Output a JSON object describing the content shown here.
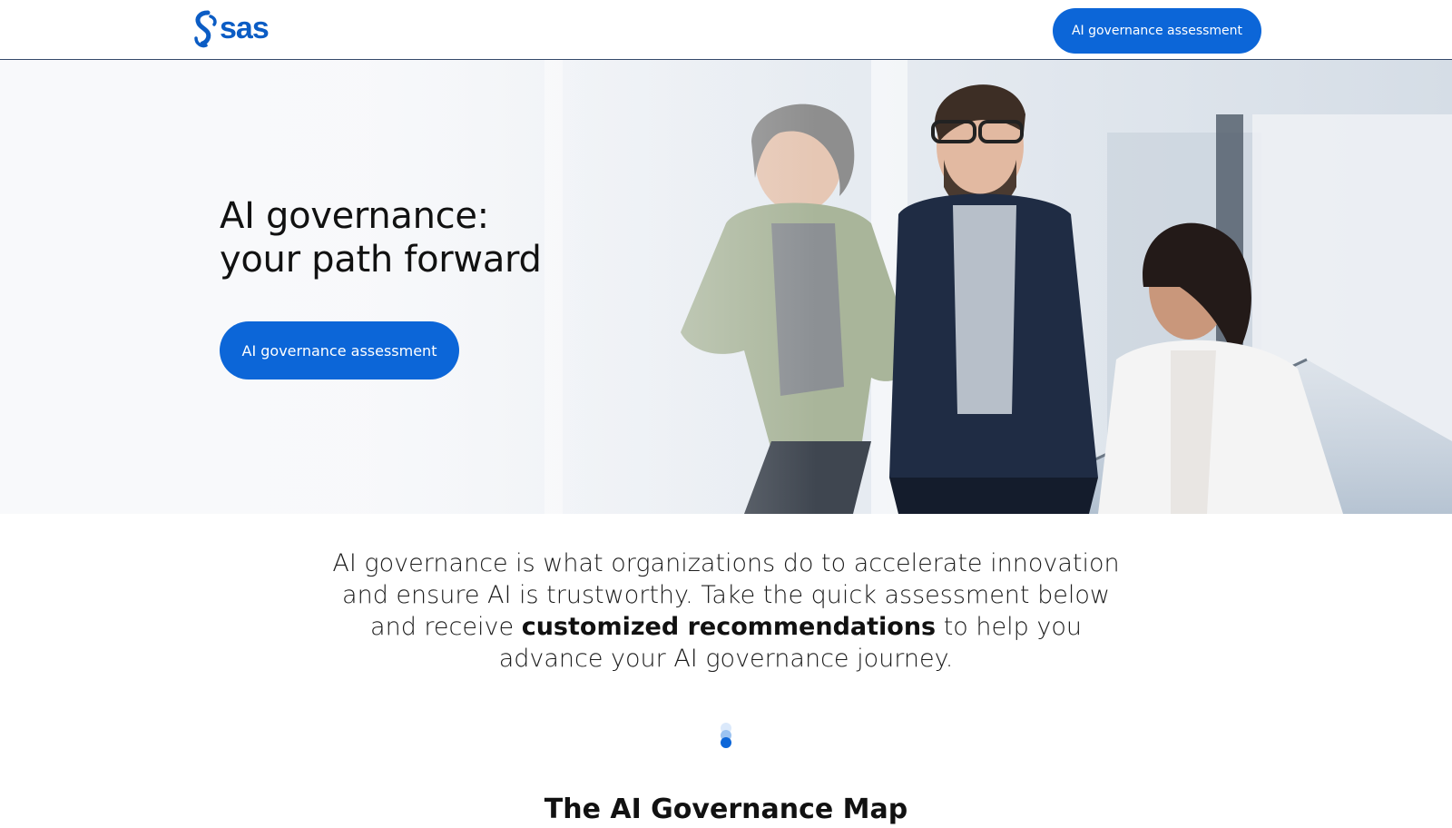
{
  "header": {
    "logo_text": "sas",
    "cta_label": "AI governance assessment"
  },
  "hero": {
    "title_line1": "AI governance:",
    "title_line2": "your path forward",
    "cta_label": "AI governance assessment"
  },
  "intro": {
    "text_before": "AI governance is what organizations do to accelerate innovation and ensure AI is trustworthy. Take the quick assessment below and receive ",
    "text_bold": "customized recommendations",
    "text_after": " to help you advance your AI governance journey."
  },
  "section": {
    "title": "The AI Governance Map"
  },
  "colors": {
    "brand_blue": "#0c66d8",
    "header_border": "#34496a",
    "text_dark": "#111111"
  }
}
